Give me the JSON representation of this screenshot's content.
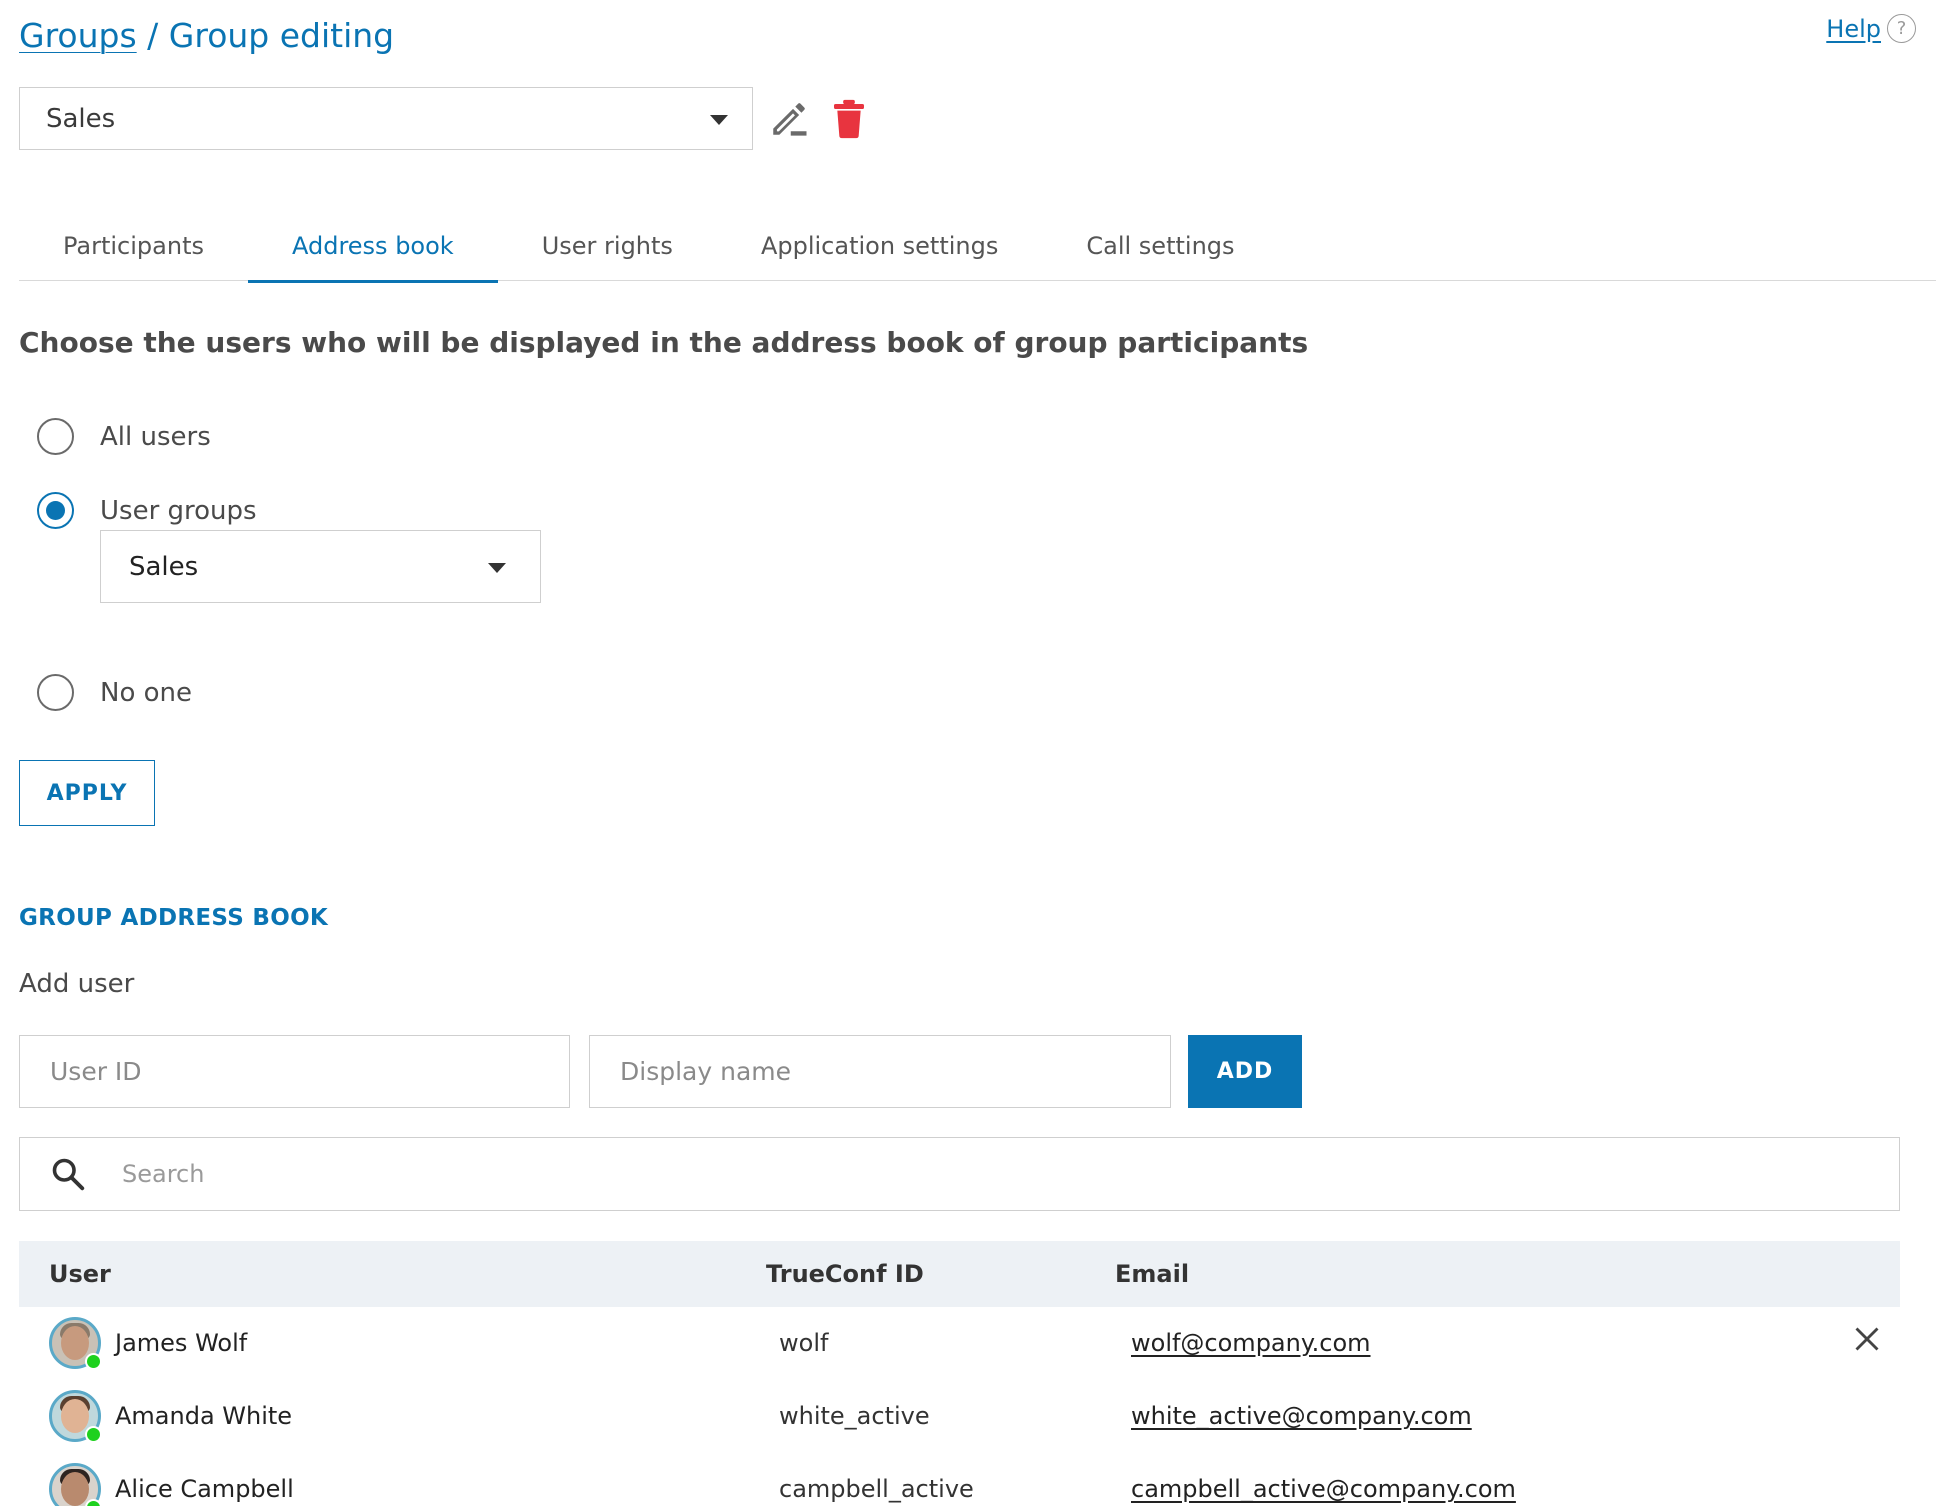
{
  "breadcrumb": {
    "groups": "Groups",
    "separator": " / ",
    "current": "Group editing"
  },
  "help": {
    "label": "Help",
    "icon": "?"
  },
  "group_select": {
    "value": "Sales"
  },
  "tabs": [
    {
      "label": "Participants"
    },
    {
      "label": "Address book",
      "active": true
    },
    {
      "label": "User rights"
    },
    {
      "label": "Application settings"
    },
    {
      "label": "Call settings"
    }
  ],
  "address_book": {
    "heading": "Choose the users who will be displayed in the address book of group participants",
    "options": [
      {
        "label": "All users",
        "checked": false
      },
      {
        "label": "User groups",
        "checked": true
      },
      {
        "label": "No one",
        "checked": false
      }
    ],
    "user_groups_select": {
      "value": "Sales"
    },
    "apply_label": "APPLY"
  },
  "group_address_book": {
    "title": "GROUP ADDRESS BOOK",
    "add_user_label": "Add user",
    "user_id_placeholder": "User ID",
    "display_name_placeholder": "Display name",
    "add_label": "ADD",
    "search_placeholder": "Search"
  },
  "table": {
    "columns": {
      "user": "User",
      "trueconf_id": "TrueConf ID",
      "email": "Email"
    },
    "rows": [
      {
        "name": "James Wolf",
        "id": "wolf",
        "email": "wolf@company.com",
        "status": "online"
      },
      {
        "name": "Amanda White",
        "id": "white_active",
        "email": "white_active@company.com",
        "status": "online"
      },
      {
        "name": "Alice Campbell",
        "id": "campbell_active",
        "email": "campbell_active@company.com",
        "status": "online"
      }
    ]
  },
  "colors": {
    "accent": "#0a74b3",
    "delete": "#e8343f",
    "online": "#1ed11e",
    "header_bg": "#edf1f5"
  },
  "icons": {
    "edit": "edit-icon",
    "delete": "trash-icon",
    "search": "search-icon",
    "remove": "close-icon",
    "dropdown": "caret-down-icon"
  }
}
